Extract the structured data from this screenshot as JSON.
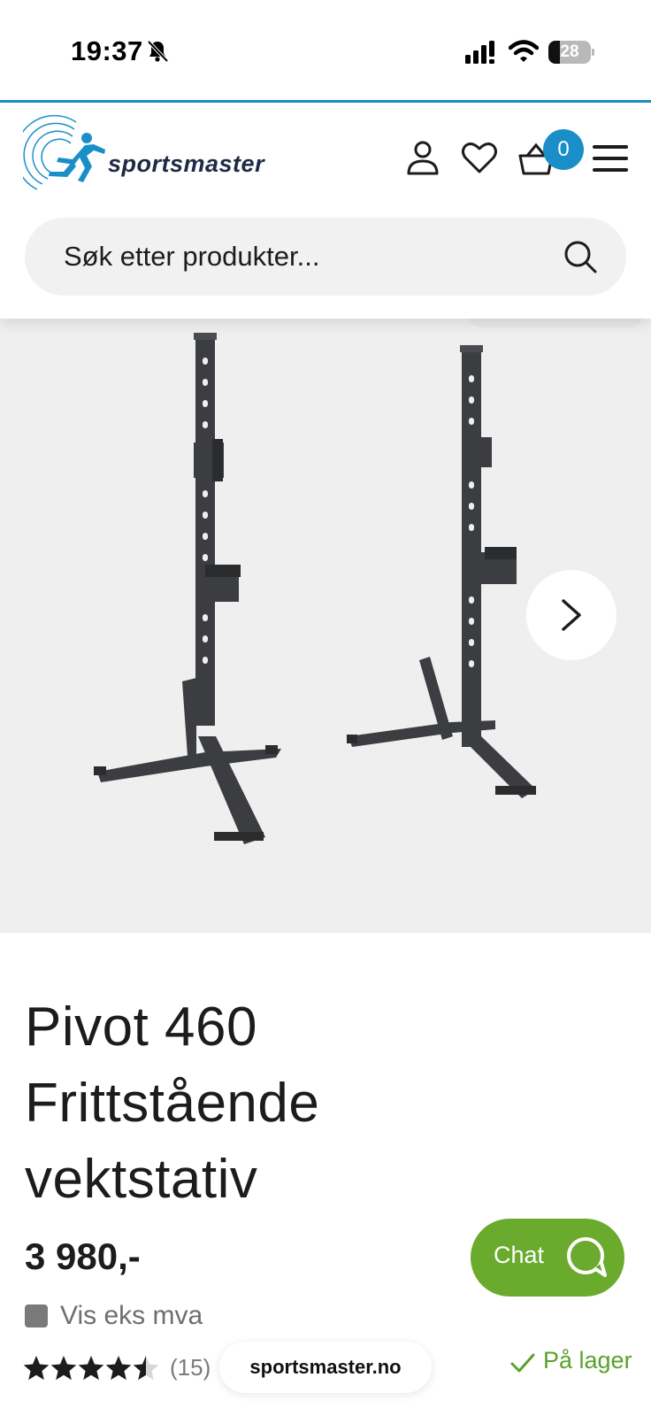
{
  "status_bar": {
    "time": "19:37",
    "battery_level": "28",
    "battery_fraction": 0.28
  },
  "header": {
    "logo_text": "sportsmaster",
    "cart_count": "0",
    "accent_color": "#1a8fc7",
    "icons": [
      "user-icon",
      "heart-icon",
      "cart-icon",
      "menu-icon"
    ]
  },
  "search": {
    "placeholder": "Søk etter produkter...",
    "value": ""
  },
  "product": {
    "title": "Pivot 460 Frittstående vektstativ",
    "price": "3 980,-",
    "vat_toggle_label": "Vis eks mva",
    "rating_value": 4.5,
    "rating_max": 5,
    "rating_count": "(15)",
    "stock_label": "På lager",
    "stock_color": "#5aa22c"
  },
  "browser": {
    "url": "sportsmaster.no"
  },
  "chat": {
    "label": "Chat",
    "color": "#6aab2e"
  }
}
